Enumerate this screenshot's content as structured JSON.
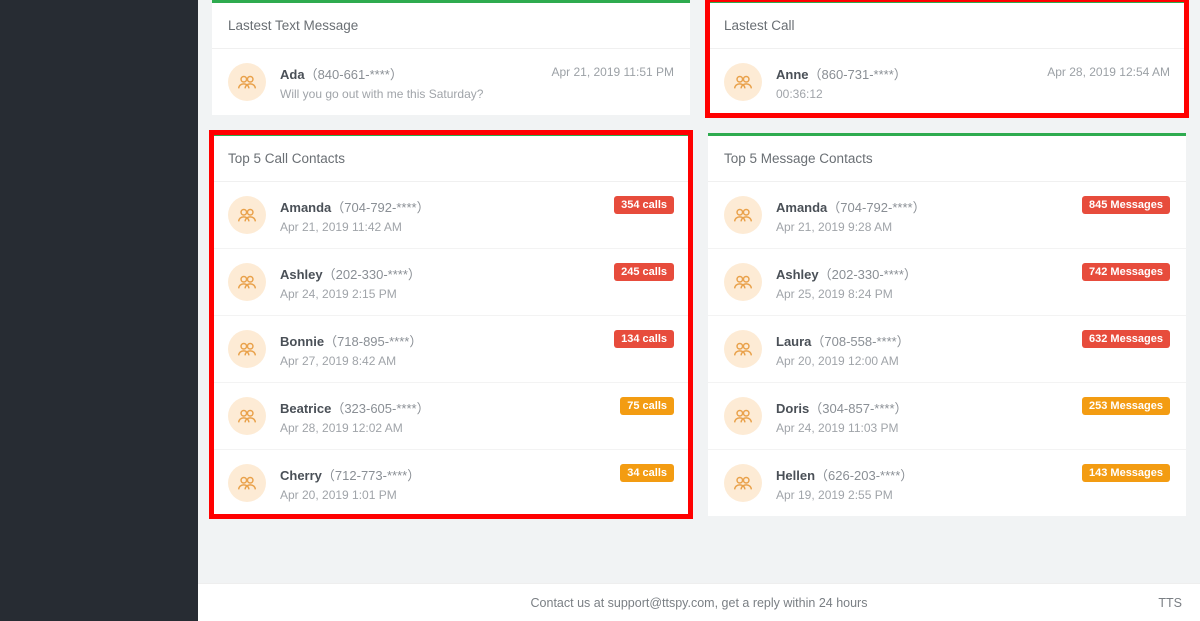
{
  "latestText": {
    "title": "Lastest Text Message",
    "name": "Ada",
    "phone": "（840-661-****）",
    "sub": "Will you go out with me this Saturday?",
    "meta": "Apr 21, 2019 11:51 PM"
  },
  "latestCall": {
    "title": "Lastest Call",
    "name": "Anne",
    "phone": "（860-731-****）",
    "sub": "00:36:12",
    "meta": "Apr 28, 2019 12:54 AM"
  },
  "topCalls": {
    "title": "Top 5 Call Contacts",
    "items": [
      {
        "name": "Amanda",
        "phone": "（704-792-****）",
        "sub": "Apr 21, 2019 11:42 AM",
        "badge": "354 calls",
        "color": "red"
      },
      {
        "name": "Ashley",
        "phone": "（202-330-****）",
        "sub": "Apr 24, 2019 2:15 PM",
        "badge": "245 calls",
        "color": "red"
      },
      {
        "name": "Bonnie",
        "phone": "（718-895-****）",
        "sub": "Apr 27, 2019 8:42 AM",
        "badge": "134 calls",
        "color": "red"
      },
      {
        "name": "Beatrice",
        "phone": "（323-605-****）",
        "sub": "Apr 28, 2019 12:02 AM",
        "badge": "75 calls",
        "color": "orange"
      },
      {
        "name": "Cherry",
        "phone": "（712-773-****）",
        "sub": "Apr 20, 2019 1:01 PM",
        "badge": "34 calls",
        "color": "orange"
      }
    ]
  },
  "topMessages": {
    "title": "Top 5 Message Contacts",
    "items": [
      {
        "name": "Amanda",
        "phone": "（704-792-****）",
        "sub": "Apr 21, 2019 9:28 AM",
        "badge": "845 Messages",
        "color": "red"
      },
      {
        "name": "Ashley",
        "phone": "（202-330-****）",
        "sub": "Apr 25, 2019 8:24 PM",
        "badge": "742 Messages",
        "color": "red"
      },
      {
        "name": "Laura",
        "phone": "（708-558-****）",
        "sub": "Apr 20, 2019 12:00 AM",
        "badge": "632 Messages",
        "color": "red"
      },
      {
        "name": "Doris",
        "phone": "（304-857-****）",
        "sub": "Apr 24, 2019 11:03 PM",
        "badge": "253 Messages",
        "color": "orange"
      },
      {
        "name": "Hellen",
        "phone": "（626-203-****）",
        "sub": "Apr 19, 2019 2:55 PM",
        "badge": "143 Messages",
        "color": "orange"
      }
    ]
  },
  "footer": {
    "text": "Contact us at support@ttspy.com, get a reply within 24 hours",
    "brand": "TTS"
  }
}
